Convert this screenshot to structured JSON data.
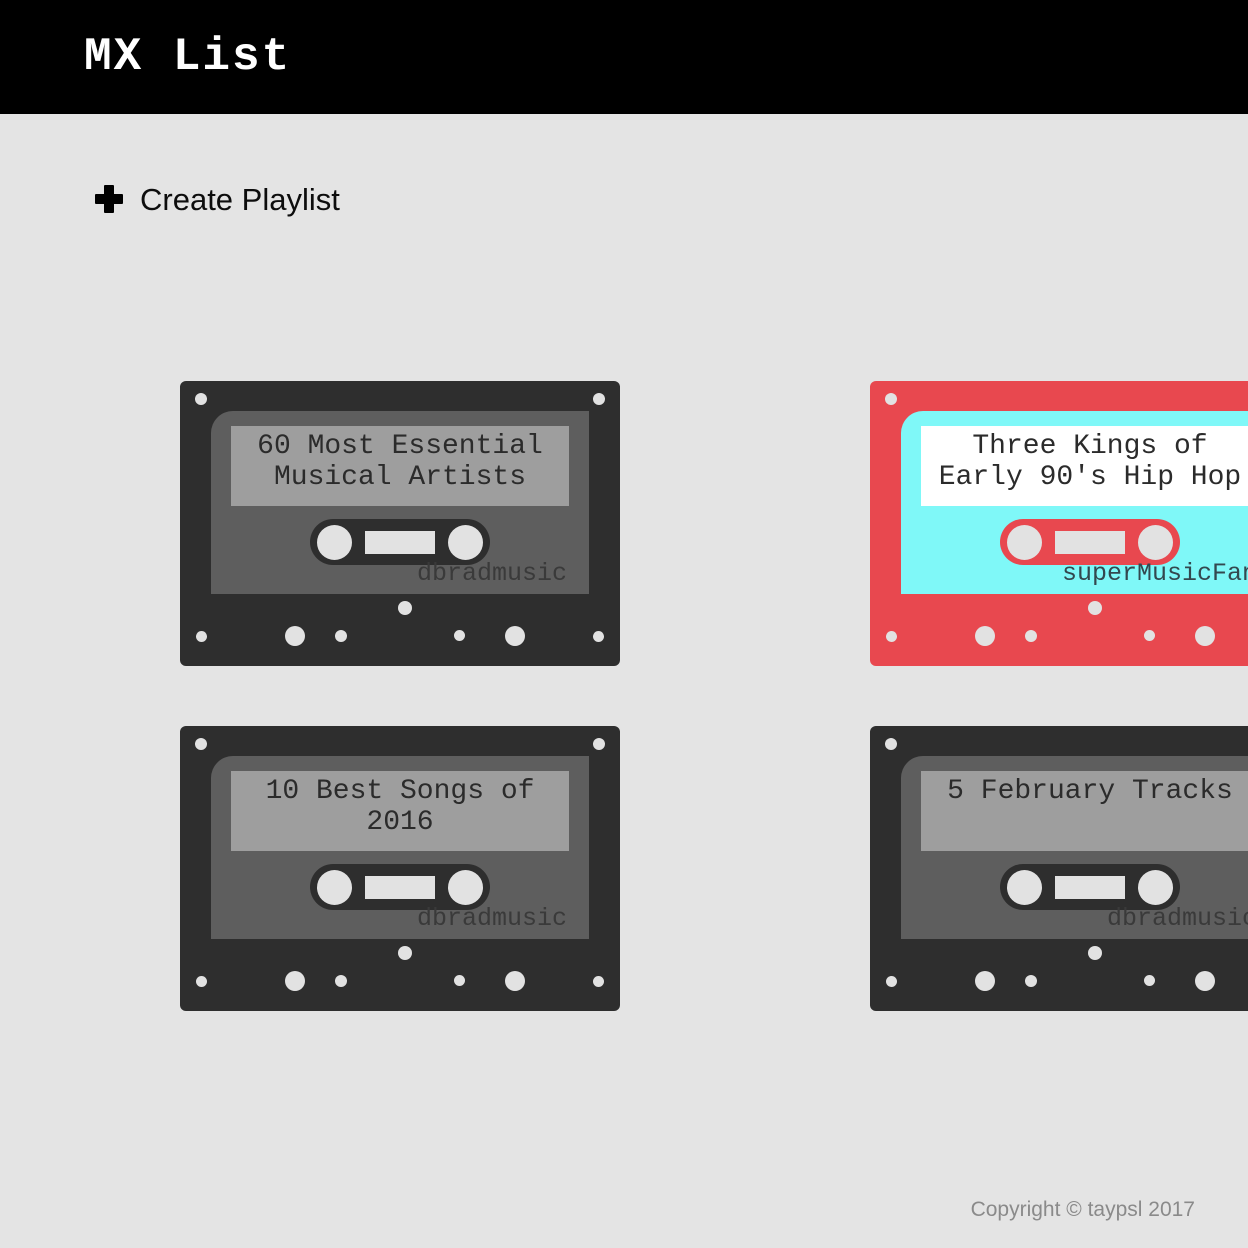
{
  "header": {
    "title": "MX List",
    "background_color": "#000000",
    "text_color": "#ffffff"
  },
  "page": {
    "background_color": "#e4e4e4"
  },
  "actions": {
    "create_playlist_label": "Create Playlist",
    "plus_icon": "plus-icon"
  },
  "playlists": [
    {
      "title": "60 Most Essential\nMusical Artists",
      "author": "dbradmusic",
      "theme": "dark",
      "shell_color": "#2e2e2e",
      "panel_color": "#5e5e5e",
      "strip_color": "#9e9e9e"
    },
    {
      "title": "Three Kings of\nEarly 90's Hip Hop",
      "author": "superMusicFan",
      "theme": "red",
      "shell_color": "#e8484f",
      "panel_color": "#7ff8f8",
      "strip_color": "#ffffff"
    },
    {
      "title": "10 Best Songs of\n2016",
      "author": "dbradmusic",
      "theme": "dark",
      "shell_color": "#2e2e2e",
      "panel_color": "#5e5e5e",
      "strip_color": "#9e9e9e"
    },
    {
      "title": "5 February Tracks",
      "author": "dbradmusic",
      "theme": "dark",
      "shell_color": "#2e2e2e",
      "panel_color": "#5e5e5e",
      "strip_color": "#9e9e9e"
    }
  ],
  "footer": {
    "copyright": "Copyright © taypsl 2017",
    "text_color": "#8a8a8a"
  }
}
